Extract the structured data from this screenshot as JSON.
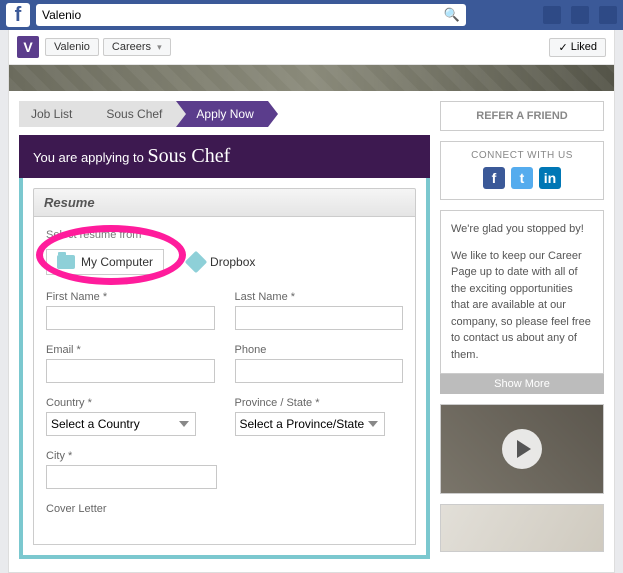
{
  "fb": {
    "search_value": "Valenio"
  },
  "page": {
    "icon_letter": "V",
    "name_tab": "Valenio",
    "careers_tab": "Careers",
    "liked_label": "Liked"
  },
  "breadcrumbs": {
    "job_list": "Job List",
    "job_title": "Sous Chef",
    "apply_now": "Apply Now"
  },
  "apply_banner": {
    "prefix": "You are applying to ",
    "job_title": "Sous Chef"
  },
  "form": {
    "resume_section_label": "Resume",
    "select_resume_from": "Select resume from",
    "my_computer_btn": "My Computer",
    "dropbox_btn": "Dropbox",
    "first_name_label": "First Name *",
    "last_name_label": "Last Name *",
    "email_label": "Email *",
    "phone_label": "Phone",
    "country_label": "Country *",
    "country_placeholder": "Select a Country",
    "province_label": "Province / State *",
    "province_placeholder": "Select a Province/State",
    "city_label": "City *",
    "cover_letter_label": "Cover Letter"
  },
  "sidebar": {
    "refer_friend": "REFER A FRIEND",
    "connect_with_us": "CONNECT WITH US",
    "welcome_line1": "We're glad you stopped by!",
    "welcome_body": "We like to keep our Career Page up to date with all of the exciting opportunities that are available at our company, so please feel free to contact us about any of them.",
    "show_more": "Show More"
  }
}
